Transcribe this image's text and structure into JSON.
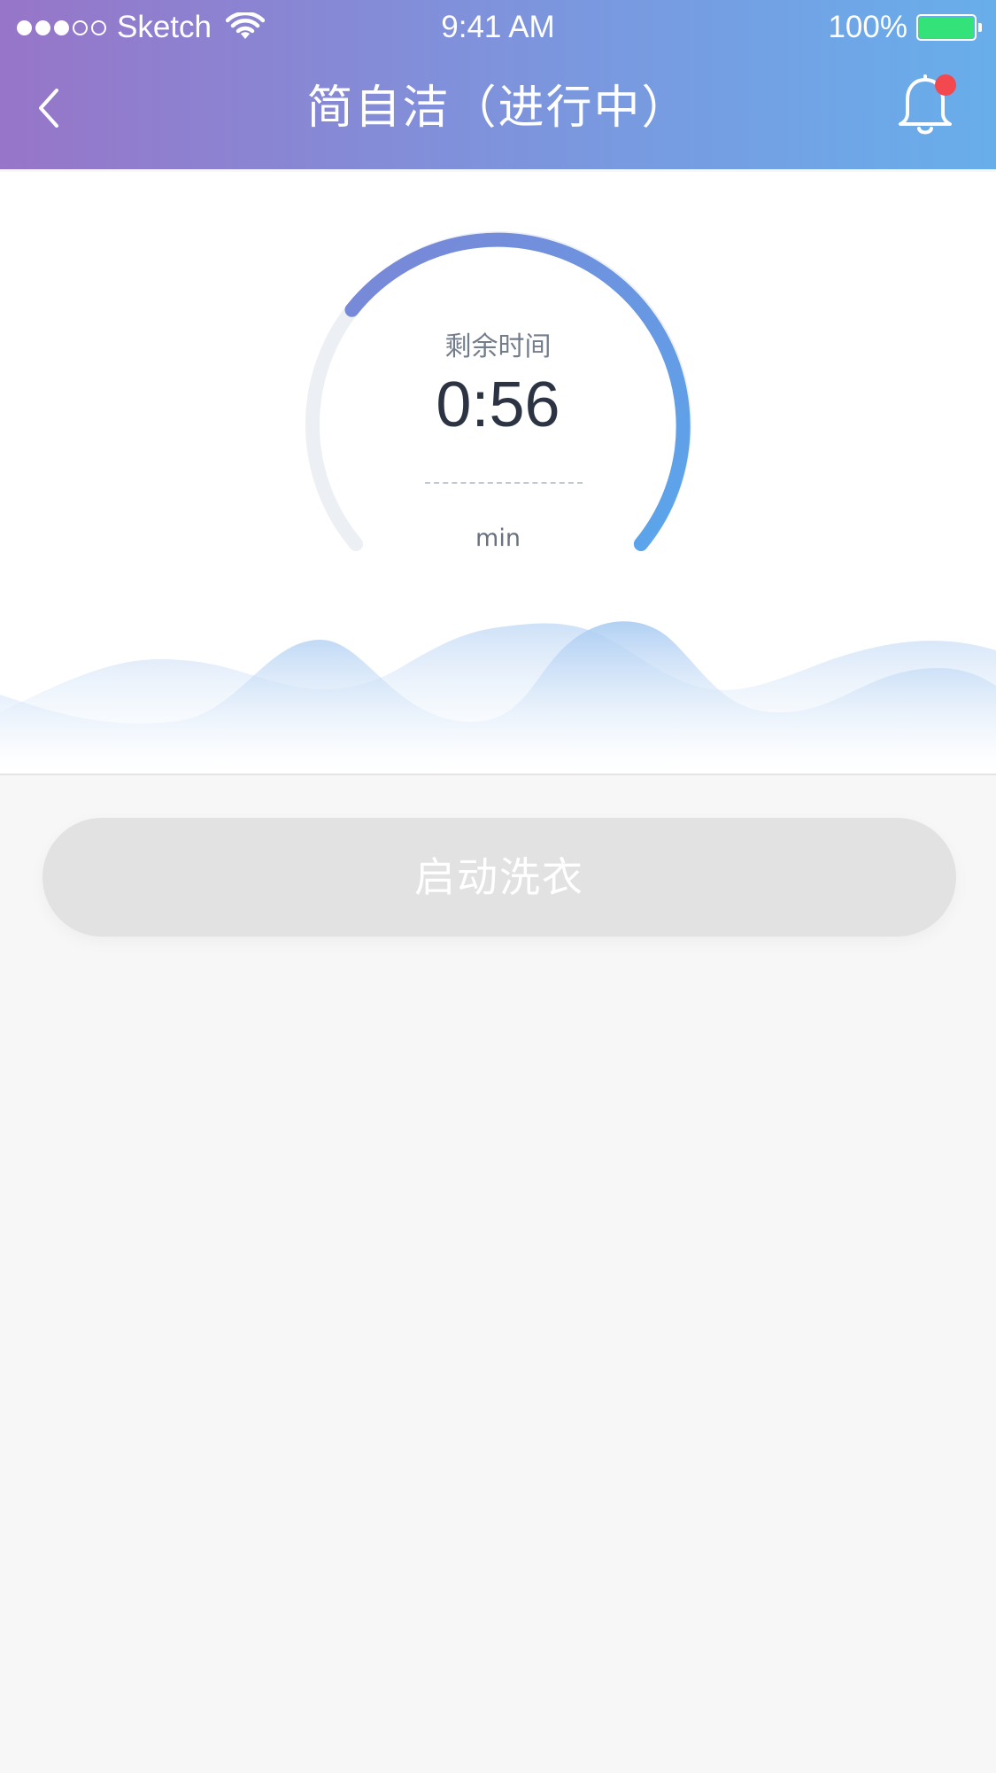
{
  "status_bar": {
    "carrier": "Sketch",
    "time": "9:41 AM",
    "battery": "100%",
    "signal_strength": 3,
    "signal_max": 5
  },
  "header": {
    "title": "简自洁（进行中）",
    "has_notification": true
  },
  "timer": {
    "label": "剩余时间",
    "value": "0:56",
    "unit": "min",
    "progress": 0.7
  },
  "actions": {
    "start_label": "启动洗衣"
  },
  "colors": {
    "header_gradient_start": "#9775c8",
    "header_gradient_end": "#68aeeb",
    "progress_start": "#7a86d6",
    "progress_end": "#5aa6ec",
    "track": "#eceff4",
    "notification": "#f2484e",
    "button_disabled": "#e2e2e2"
  },
  "icons": {
    "back": "chevron-left-icon",
    "notification": "bell-icon",
    "wifi": "wifi-icon",
    "battery": "battery-icon"
  }
}
